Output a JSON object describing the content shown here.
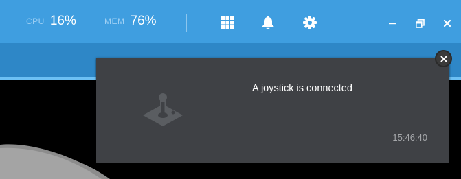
{
  "header": {
    "cpu": {
      "label": "CPU",
      "value": "16%"
    },
    "mem": {
      "label": "MEM",
      "value": "76%"
    },
    "icons": [
      "apps-grid-icon",
      "bell-icon",
      "gear-icon",
      "minimize-icon",
      "restore-icon",
      "close-icon"
    ]
  },
  "notification": {
    "message": "A joystick is connected",
    "time": "15:46:40",
    "icon": "joystick-icon",
    "close_icon": "close-icon"
  },
  "colors": {
    "topbar": "#3f9ee0",
    "subbar": "#2e87c7",
    "toast_bg": "#3f4145",
    "accent_line": "#6cc0f4"
  }
}
